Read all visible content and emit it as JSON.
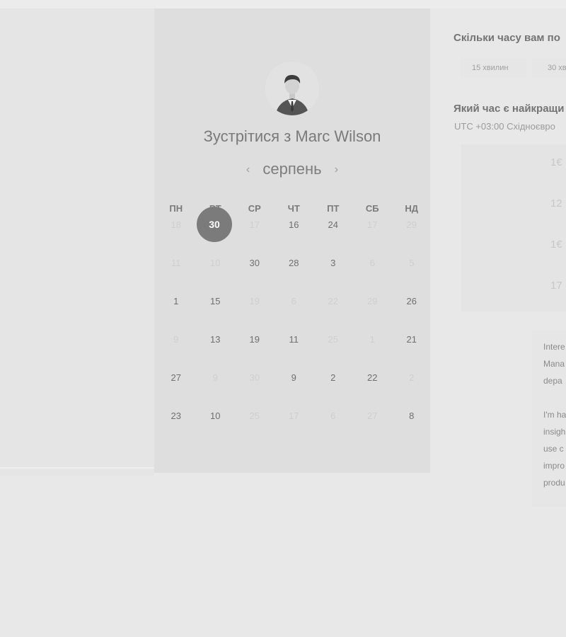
{
  "meeting": {
    "title": "Зустрітися з Marc Wilson"
  },
  "calendar": {
    "month": "серпень",
    "prev_icon": "chevron-left-icon",
    "next_icon": "chevron-right-icon",
    "weekdays": [
      "ПН",
      "ВТ",
      "СР",
      "ЧТ",
      "ПТ",
      "СБ",
      "НД"
    ],
    "selected_day": "30",
    "weeks": [
      [
        {
          "d": "18",
          "dim": true
        },
        {
          "d": "",
          "dim": false
        },
        {
          "d": "17",
          "dim": true
        },
        {
          "d": "16",
          "dim": false
        },
        {
          "d": "24",
          "dim": false
        },
        {
          "d": "17",
          "dim": true
        },
        {
          "d": "29",
          "dim": true
        }
      ],
      [
        {
          "d": "11",
          "dim": true
        },
        {
          "d": "10",
          "dim": true
        },
        {
          "d": "30",
          "dim": false
        },
        {
          "d": "28",
          "dim": false
        },
        {
          "d": "3",
          "dim": false
        },
        {
          "d": "6",
          "dim": true
        },
        {
          "d": "5",
          "dim": true
        }
      ],
      [
        {
          "d": "1",
          "dim": false
        },
        {
          "d": "15",
          "dim": false
        },
        {
          "d": "19",
          "dim": true
        },
        {
          "d": "6",
          "dim": true
        },
        {
          "d": "22",
          "dim": true
        },
        {
          "d": "29",
          "dim": true
        },
        {
          "d": "26",
          "dim": false
        }
      ],
      [
        {
          "d": "9",
          "dim": true
        },
        {
          "d": "13",
          "dim": false
        },
        {
          "d": "19",
          "dim": false
        },
        {
          "d": "11",
          "dim": false
        },
        {
          "d": "25",
          "dim": true
        },
        {
          "d": "1",
          "dim": true
        },
        {
          "d": "21",
          "dim": false
        }
      ],
      [
        {
          "d": "27",
          "dim": false
        },
        {
          "d": "9",
          "dim": true
        },
        {
          "d": "30",
          "dim": true
        },
        {
          "d": "9",
          "dim": false
        },
        {
          "d": "2",
          "dim": false
        },
        {
          "d": "22",
          "dim": false
        },
        {
          "d": "2",
          "dim": true
        }
      ],
      [
        {
          "d": "23",
          "dim": false
        },
        {
          "d": "10",
          "dim": false
        },
        {
          "d": "25",
          "dim": true
        },
        {
          "d": "17",
          "dim": true
        },
        {
          "d": "6",
          "dim": true
        },
        {
          "d": "27",
          "dim": true
        },
        {
          "d": "8",
          "dim": false
        }
      ]
    ]
  },
  "duration": {
    "question": "Скільки часу вам по",
    "options": [
      "15 хвилин",
      "30 хв"
    ]
  },
  "time": {
    "question": "Який час є найкращи",
    "timezone": "UTC +03:00 Східноєвро",
    "slots": [
      "1€",
      "12",
      "1€",
      "17"
    ]
  },
  "info": {
    "p1": "Intere\nMana\ndepa",
    "p2": "I'm ha\ninsigh\nuse c\nimpro\nprodu"
  },
  "colors": {
    "background": "#e8e8e8",
    "panel": "#dedede",
    "selected_day": "#7b7b7b"
  }
}
